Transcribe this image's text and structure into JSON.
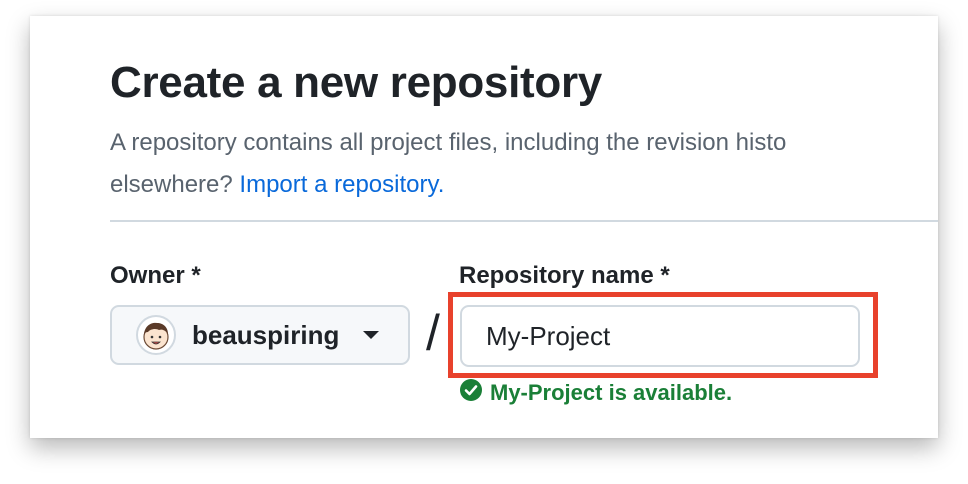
{
  "header": {
    "title": "Create a new repository"
  },
  "description": {
    "line1": "A repository contains all project files, including the revision histo",
    "line2_prefix": "elsewhere? ",
    "import_link": "Import a repository."
  },
  "owner": {
    "label": "Owner *",
    "selected": "beauspiring"
  },
  "separator": "/",
  "repository": {
    "label": "Repository name *",
    "value": "My-Project",
    "availability": "My-Project is available."
  },
  "icons": {
    "avatar": "avatar",
    "dropdown": "chevron-down-icon",
    "availability": "check-circle-icon"
  },
  "colors": {
    "highlight": "#e8412c",
    "link": "#0969da",
    "success": "#1a7f37"
  }
}
